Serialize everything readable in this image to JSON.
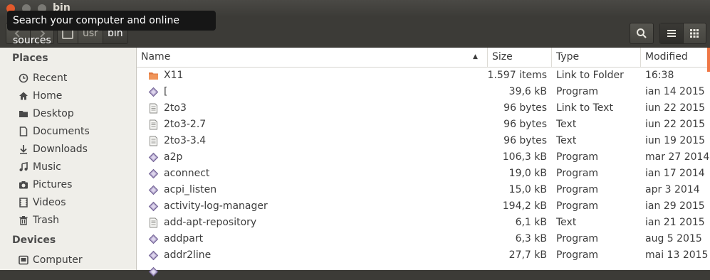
{
  "window": {
    "title": "bin"
  },
  "tooltip": {
    "text": "Search your computer and online sources"
  },
  "breadcrumbs": [
    {
      "label": ""
    },
    {
      "label": "usr"
    },
    {
      "label": "bin"
    }
  ],
  "sidebar": {
    "places_title": "Places",
    "places": [
      {
        "label": "Recent",
        "icon": "clock-icon"
      },
      {
        "label": "Home",
        "icon": "home-icon"
      },
      {
        "label": "Desktop",
        "icon": "folder-icon"
      },
      {
        "label": "Documents",
        "icon": "document-icon"
      },
      {
        "label": "Downloads",
        "icon": "download-icon"
      },
      {
        "label": "Music",
        "icon": "music-icon"
      },
      {
        "label": "Pictures",
        "icon": "camera-icon"
      },
      {
        "label": "Videos",
        "icon": "film-icon"
      },
      {
        "label": "Trash",
        "icon": "trash-icon"
      }
    ],
    "devices_title": "Devices",
    "devices": [
      {
        "label": "Computer",
        "icon": "drive-icon"
      }
    ]
  },
  "columns": {
    "name": "Name",
    "size": "Size",
    "type": "Type",
    "modified": "Modified"
  },
  "files": [
    {
      "name": "X11",
      "size": "1.597 items",
      "type": "Link to Folder",
      "modified": "16:38",
      "icon": "folder"
    },
    {
      "name": "[",
      "size": "39,6 kB",
      "type": "Program",
      "modified": "ian 14 2015",
      "icon": "program"
    },
    {
      "name": "2to3",
      "size": "96 bytes",
      "type": "Link to Text",
      "modified": "iun 22 2015",
      "icon": "text"
    },
    {
      "name": "2to3-2.7",
      "size": "96 bytes",
      "type": "Text",
      "modified": "iun 22 2015",
      "icon": "text"
    },
    {
      "name": "2to3-3.4",
      "size": "96 bytes",
      "type": "Text",
      "modified": "iun 19 2015",
      "icon": "text"
    },
    {
      "name": "a2p",
      "size": "106,3 kB",
      "type": "Program",
      "modified": "mar 27 2014",
      "icon": "program"
    },
    {
      "name": "aconnect",
      "size": "19,0 kB",
      "type": "Program",
      "modified": "ian 17 2014",
      "icon": "program"
    },
    {
      "name": "acpi_listen",
      "size": "15,0 kB",
      "type": "Program",
      "modified": "apr 3 2014",
      "icon": "program"
    },
    {
      "name": "activity-log-manager",
      "size": "194,2 kB",
      "type": "Program",
      "modified": "ian 29 2015",
      "icon": "program"
    },
    {
      "name": "add-apt-repository",
      "size": "6,1 kB",
      "type": "Text",
      "modified": "ian 21 2015",
      "icon": "text"
    },
    {
      "name": "addpart",
      "size": "6,3 kB",
      "type": "Program",
      "modified": "aug 5 2015",
      "icon": "program"
    },
    {
      "name": "addr2line",
      "size": "27,7 kB",
      "type": "Program",
      "modified": "mai 13 2015",
      "icon": "program"
    },
    {
      "name": "",
      "size": "",
      "type": "",
      "modified": "",
      "icon": "program"
    }
  ],
  "colors": {
    "accent": "#f07746",
    "close": "#e25a2c",
    "sidebar": "#efeee9",
    "toolbar": "#3c3b37"
  }
}
